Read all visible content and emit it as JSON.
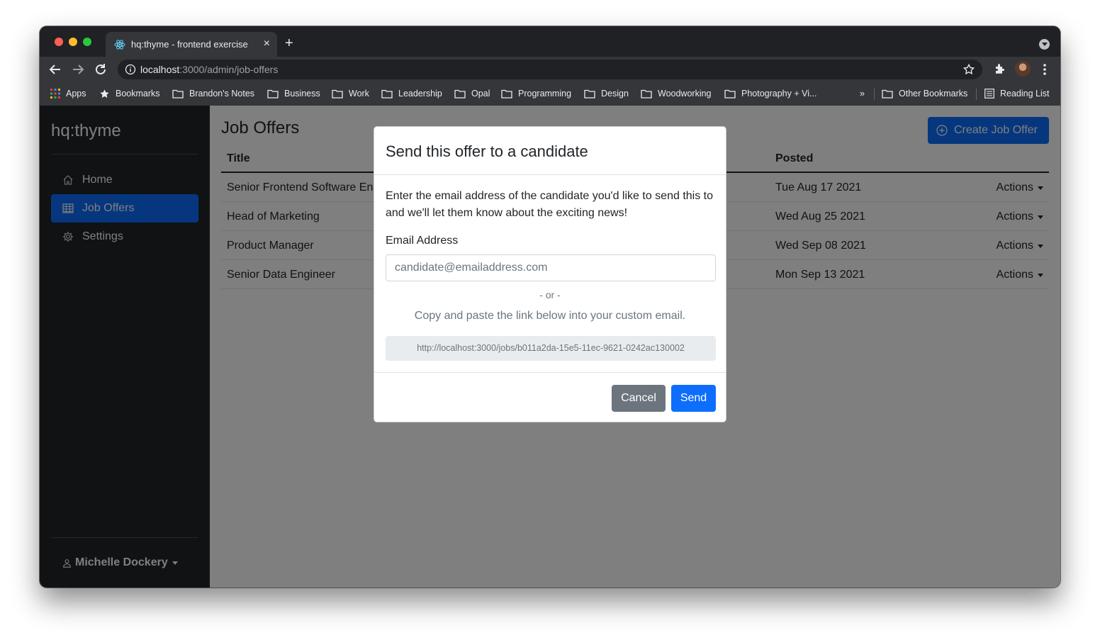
{
  "browser": {
    "tab_title": "hq:thyme - frontend exercise",
    "tab_close": "×",
    "new_tab": "+",
    "url_host": "localhost",
    "url_path": ":3000/admin/job-offers",
    "bookmarks": [
      {
        "label": "Apps",
        "icon": "apps-grid-icon"
      },
      {
        "label": "Bookmarks",
        "icon": "star-icon"
      },
      {
        "label": "Brandon's Notes",
        "icon": "folder-icon"
      },
      {
        "label": "Business",
        "icon": "folder-icon"
      },
      {
        "label": "Work",
        "icon": "folder-icon"
      },
      {
        "label": "Leadership",
        "icon": "folder-icon"
      },
      {
        "label": "Opal",
        "icon": "folder-icon"
      },
      {
        "label": "Programming",
        "icon": "folder-icon"
      },
      {
        "label": "Design",
        "icon": "folder-icon"
      },
      {
        "label": "Woodworking",
        "icon": "folder-icon"
      },
      {
        "label": "Photography + Vi...",
        "icon": "folder-icon"
      }
    ],
    "bookmarks_overflow": "»",
    "other_bookmarks": "Other Bookmarks",
    "reading_list": "Reading List"
  },
  "sidebar": {
    "brand": "hq:thyme",
    "items": [
      {
        "label": "Home",
        "icon": "home-icon"
      },
      {
        "label": "Job Offers",
        "icon": "table-icon"
      },
      {
        "label": "Settings",
        "icon": "gear-icon"
      }
    ],
    "user_name": "Michelle Dockery"
  },
  "main": {
    "title": "Job Offers",
    "create_button": "Create Job Offer",
    "table": {
      "headers": [
        "Title",
        "Posted"
      ],
      "rows": [
        {
          "title": "Senior Frontend Software En",
          "posted": "Tue Aug 17 2021",
          "actions": "Actions"
        },
        {
          "title": "Head of Marketing",
          "posted": "Wed Aug 25 2021",
          "actions": "Actions"
        },
        {
          "title": "Product Manager",
          "posted": "Wed Sep 08 2021",
          "actions": "Actions"
        },
        {
          "title": "Senior Data Engineer",
          "posted": "Mon Sep 13 2021",
          "actions": "Actions"
        }
      ]
    }
  },
  "modal": {
    "title": "Send this offer to a candidate",
    "body": "Enter the email address of the candidate you'd like to send this to and we'll let them know about the exciting news!",
    "email_label": "Email Address",
    "email_placeholder": "candidate@emailaddress.com",
    "email_value": "",
    "or_text": "- or -",
    "copy_text": "Copy and paste the link below into your custom email.",
    "link": "http://localhost:3000/jobs/b011a2da-15e5-11ec-9621-0242ac130002",
    "cancel": "Cancel",
    "send": "Send"
  },
  "colors": {
    "primary": "#0d6efd",
    "secondary": "#6c757d",
    "sidebar_bg": "#212529",
    "browser_chrome": "#35363a"
  }
}
